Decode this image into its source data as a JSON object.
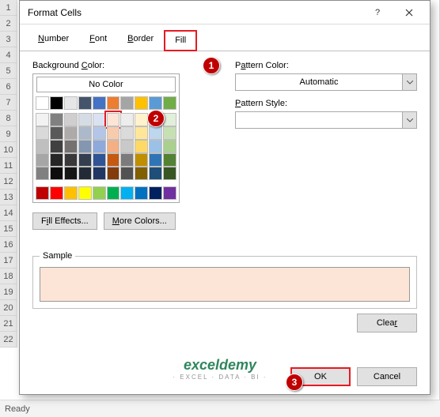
{
  "rows": [
    "1",
    "2",
    "3",
    "4",
    "5",
    "6",
    "7",
    "8",
    "9",
    "10",
    "11",
    "12",
    "13",
    "14",
    "15",
    "16",
    "17",
    "18",
    "19",
    "20",
    "21",
    "22"
  ],
  "title": "Format Cells",
  "tabs": {
    "number": "Number",
    "font": "Font",
    "border": "Border",
    "fill": "Fill"
  },
  "bgLabel": "Background Color:",
  "noColor": "No Color",
  "fillEffects": "Fill Effects...",
  "moreColors": "More Colors...",
  "patternColor": "Pattern Color:",
  "automatic": "Automatic",
  "patternStyle": "Pattern Style:",
  "sample": "Sample",
  "clear": "Clear",
  "ok": "OK",
  "cancel": "Cancel",
  "ready": "Ready",
  "callouts": {
    "c1": "1",
    "c2": "2",
    "c3": "3"
  },
  "wm1": "exceldemy",
  "wm2": "· EXCEL · DATA · BI ·",
  "palette": [
    [
      "#ffffff",
      "#000000",
      "#e7e6e6",
      "#44546a",
      "#4472c4",
      "#ed7d31",
      "#a5a5a5",
      "#ffc000",
      "#5b9bd5",
      "#70ad47"
    ],
    [
      "#f2f2f2",
      "#808080",
      "#d0cece",
      "#d6dce4",
      "#d9e1f2",
      "#fce4d6",
      "#ededed",
      "#fff2cc",
      "#ddebf7",
      "#e2efda"
    ],
    [
      "#d9d9d9",
      "#595959",
      "#aeaaaa",
      "#acb9ca",
      "#b4c6e7",
      "#f8cbad",
      "#dbdbdb",
      "#ffe699",
      "#bdd7ee",
      "#c6e0b4"
    ],
    [
      "#bfbfbf",
      "#404040",
      "#757171",
      "#8497b0",
      "#8ea9db",
      "#f4b084",
      "#c9c9c9",
      "#ffd966",
      "#9bc2e6",
      "#a9d08e"
    ],
    [
      "#a6a6a6",
      "#262626",
      "#3a3838",
      "#333f4f",
      "#305496",
      "#c65911",
      "#7b7b7b",
      "#bf8f00",
      "#2f75b5",
      "#548235"
    ],
    [
      "#808080",
      "#0d0d0d",
      "#161616",
      "#222b35",
      "#203764",
      "#833c0c",
      "#525252",
      "#806000",
      "#1f4e78",
      "#375623"
    ]
  ],
  "standard": [
    "#c00000",
    "#ff0000",
    "#ffc000",
    "#ffff00",
    "#92d050",
    "#00b050",
    "#00b0f0",
    "#0070c0",
    "#002060",
    "#7030a0"
  ]
}
